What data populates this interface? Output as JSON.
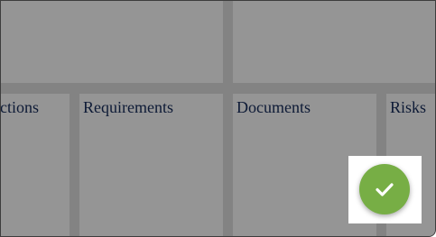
{
  "columns": [
    {
      "label": "Actions"
    },
    {
      "label": "Requirements"
    },
    {
      "label": "Documents"
    },
    {
      "label": "Risks"
    }
  ],
  "fab": {
    "icon": "checkmark-icon",
    "color": "#77ae45"
  },
  "colors": {
    "overlay": "#838383",
    "tile": "#959595",
    "label_text": "#0d1a36"
  }
}
